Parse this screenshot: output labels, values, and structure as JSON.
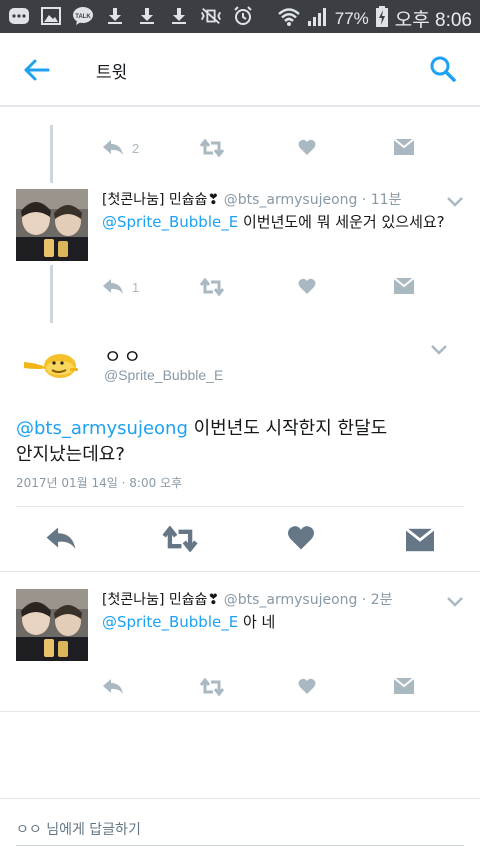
{
  "status_bar": {
    "battery": "77%",
    "time": "오후 8:06",
    "talk_label": "TALK"
  },
  "toolbar": {
    "title": "트윗"
  },
  "tweets": [
    {
      "name": "[첫콘나눔] 민슙슙❣",
      "handle": "@bts_armysujeong",
      "time": "· 11분",
      "mention": "@Sprite_Bubble_E",
      "text": " 이번년도에 뭐 세운거 있으세요?",
      "reply_count": "1"
    },
    {
      "name": "[첫콘나눔] 민슙슙❣",
      "handle": "@bts_armysujeong",
      "time": "· 2분",
      "mention": "@Sprite_Bubble_E",
      "text": " 아 네"
    }
  ],
  "top_actions": {
    "reply_count": "2"
  },
  "main_tweet": {
    "name": "ㅇㅇ",
    "handle": "@Sprite_Bubble_E",
    "mention": "@bts_armysujeong",
    "text_line1": " 이번년도 시작한지 한달도",
    "text_line2": "안지났는데요?",
    "date": "2017년 01월 14일 · 8:00 오후"
  },
  "reply_box": {
    "placeholder": "ㅇㅇ 님에게 답글하기"
  },
  "colors": {
    "accent": "#1da1f2",
    "icon_gray": "#aab8c2",
    "icon_dark": "#657786",
    "status_bar": "#3b3f44"
  }
}
